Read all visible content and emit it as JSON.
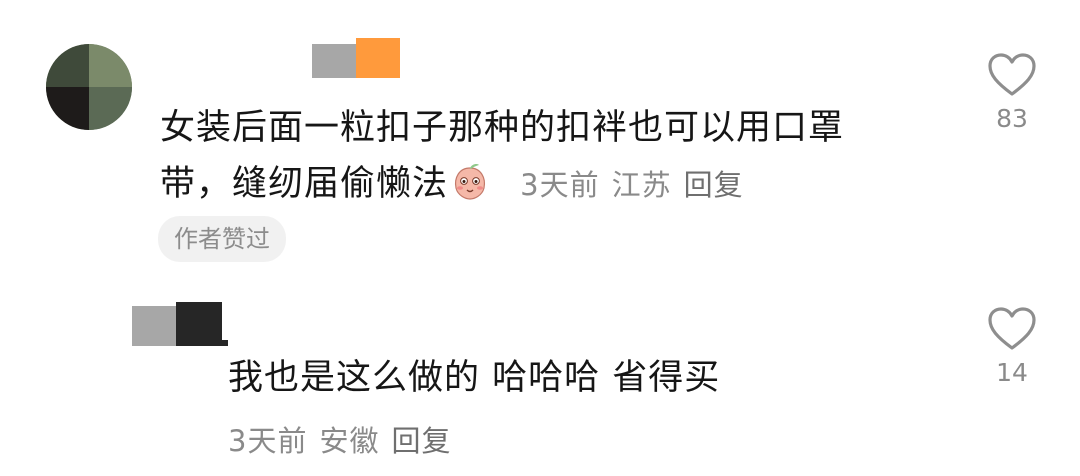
{
  "comments": [
    {
      "text_line1": "女装后面一粒扣子那种的扣袢也可以用口罩",
      "text_line2": "带，缝纫届偷懒法",
      "emoji": "blushing-peach-emoji",
      "time": "3天前",
      "location": "江苏",
      "reply_label": "回复",
      "badge": "作者赞过",
      "like_count": "83"
    },
    {
      "text": "我也是这么做的 哈哈哈  省得买",
      "time": "3天前",
      "location": "安徽",
      "reply_label": "回复",
      "like_count": "14"
    }
  ],
  "icons": {
    "like": "heart-outline-icon"
  },
  "colors": {
    "meta_gray": "#8a8a8a",
    "badge_bg": "#f1f1f1",
    "censor_orange": "#ff9a3c",
    "censor_gray": "#a7a7a7",
    "censor_dark": "#262626"
  }
}
